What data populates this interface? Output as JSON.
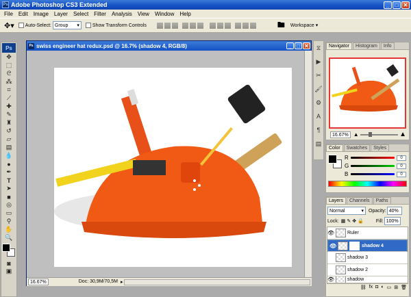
{
  "app": {
    "title": "Adobe Photoshop CS3 Extended",
    "logo": "Ps"
  },
  "menus": [
    "File",
    "Edit",
    "Image",
    "Layer",
    "Select",
    "Filter",
    "Analysis",
    "View",
    "Window",
    "Help"
  ],
  "options": {
    "auto_select_label": "Auto-Select:",
    "auto_select_value": "Group",
    "transform_label": "Show Transform Controls",
    "workspace_label": "Workspace ▾"
  },
  "document": {
    "title": "swiss engineer hat redux.psd @ 16.7% (shadow 4, RGB/8)",
    "zoom": "16.67%",
    "doc_info": "Doc: 30,9M/70,5M"
  },
  "navigator": {
    "tabs": [
      "Navigator",
      "Histogram",
      "Info"
    ],
    "zoom": "16.67%"
  },
  "color_panel": {
    "tabs": [
      "Color",
      "Swatches",
      "Styles"
    ],
    "channels": [
      {
        "label": "R",
        "value": "0",
        "color": "#ff0000"
      },
      {
        "label": "G",
        "value": "0",
        "color": "#00a000"
      },
      {
        "label": "B",
        "value": "0",
        "color": "#0000ff"
      }
    ]
  },
  "layers_panel": {
    "tabs": [
      "Layers",
      "Channels",
      "Paths"
    ],
    "blend_mode": "Normal",
    "opacity_label": "Opacity:",
    "opacity": "40%",
    "lock_label": "Lock:",
    "fill_label": "Fill:",
    "fill": "100%",
    "layers": [
      {
        "name": "Ruler",
        "visible": true,
        "selected": false
      },
      {
        "name": "shadow 4",
        "visible": true,
        "selected": true
      },
      {
        "name": "shadow 3",
        "visible": false,
        "selected": false
      },
      {
        "name": "shadow 2",
        "visible": false,
        "selected": false
      },
      {
        "name": "shadow",
        "visible": true,
        "selected": false
      }
    ]
  },
  "colors": {
    "accent": "#3169c6",
    "title_bar": "#1551c4",
    "helmet": "#f05a14"
  }
}
